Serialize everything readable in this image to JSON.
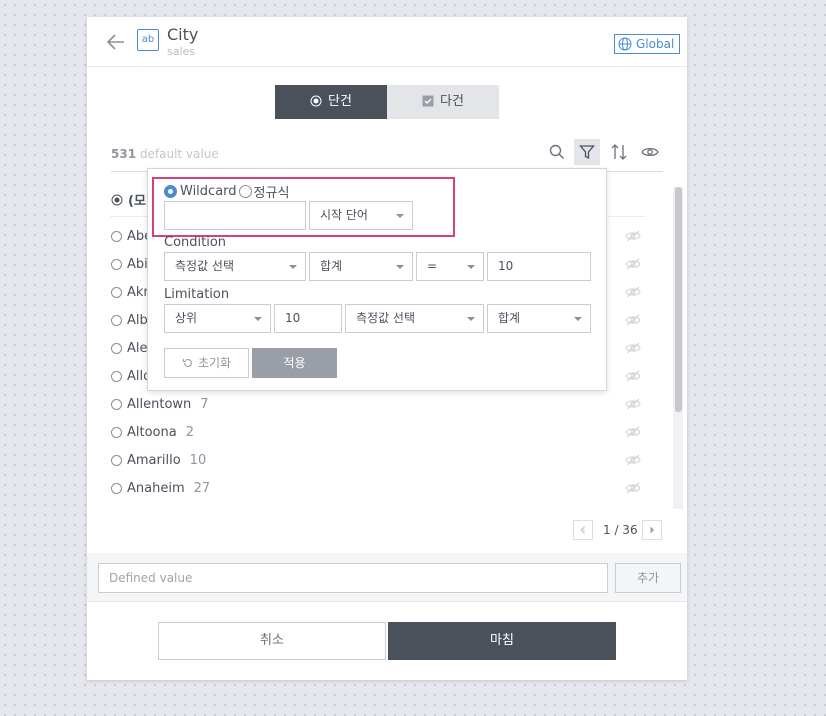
{
  "header": {
    "title": "City",
    "subtitle": "sales",
    "type_badge": "ab",
    "global_label": "Global"
  },
  "mode_tabs": [
    {
      "label": "단건",
      "selected": true
    },
    {
      "label": "다건",
      "selected": false
    }
  ],
  "summary": {
    "count": "531",
    "default_label": "default value"
  },
  "list": {
    "all_label": "(모",
    "items": [
      {
        "name": "Abe",
        "count": ""
      },
      {
        "name": "Abi",
        "count": ""
      },
      {
        "name": "Akr",
        "count": ""
      },
      {
        "name": "Alb",
        "count": ""
      },
      {
        "name": "Ale",
        "count": ""
      },
      {
        "name": "Allo",
        "count": ""
      },
      {
        "name": "Allentown",
        "count": "7"
      },
      {
        "name": "Altoona",
        "count": "2"
      },
      {
        "name": "Amarillo",
        "count": "10"
      },
      {
        "name": "Anaheim",
        "count": "27"
      }
    ]
  },
  "pagination": {
    "text": "1 / 36"
  },
  "filter_popup": {
    "match_options": [
      {
        "label": "Wildcard",
        "selected": true
      },
      {
        "label": "정규식",
        "selected": false
      }
    ],
    "wildcard_value": "",
    "wildcard_mode": "시작 단어",
    "condition_label": "Condition",
    "condition": {
      "measure": "측정값 선택",
      "aggregation": "합계",
      "operator": "=",
      "value": "10"
    },
    "limitation_label": "Limitation",
    "limitation": {
      "direction": "상위",
      "value": "10",
      "measure": "측정값 선택",
      "aggregation": "합계"
    },
    "reset_label": "초기화",
    "apply_label": "적용"
  },
  "footer": {
    "defined_placeholder": "Defined value",
    "add_label": "추가",
    "cancel_label": "취소",
    "done_label": "마침"
  },
  "colors": {
    "accent": "#4b8ad6",
    "dark": "#4b515b",
    "highlight": "#d6407a"
  }
}
